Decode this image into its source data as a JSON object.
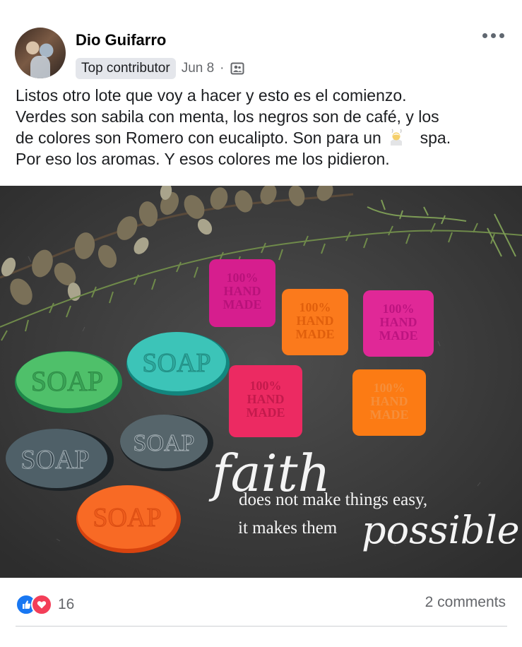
{
  "post": {
    "author": "Dio Guifarro",
    "badge": "Top contributor",
    "date": "Jun 8",
    "separator": "·",
    "audience_icon": "group-audience-icon",
    "more_icon": "more-options-icon",
    "text_lines": [
      "Listos otro lote que voy a hacer y esto es el comienzo.",
      "Verdes son sabila con menta, los negros son de café, y los",
      "de colores son Romero con eucalipto. Son para un",
      "Por eso los aromas. Y esos colores me los pidieron."
    ],
    "text_emoji": "person-in-steamy-room-icon",
    "text_line3_after": "spa."
  },
  "photo": {
    "soap_labels": [
      "SOAP",
      "SOAP",
      "SOAP",
      "SOAP",
      "SOAP"
    ],
    "handmade_lines": [
      "100%",
      "HAND",
      "MADE"
    ],
    "quote_word1": "faith",
    "quote_line1": "does not make things easy,",
    "quote_line2": "it makes them",
    "quote_word2": "possible"
  },
  "footer": {
    "reaction_count": "16",
    "comments": "2 comments"
  },
  "colors": {
    "like_blue": "#1877f2",
    "love_red": "#f33e58",
    "meta_gray": "#65676b"
  }
}
